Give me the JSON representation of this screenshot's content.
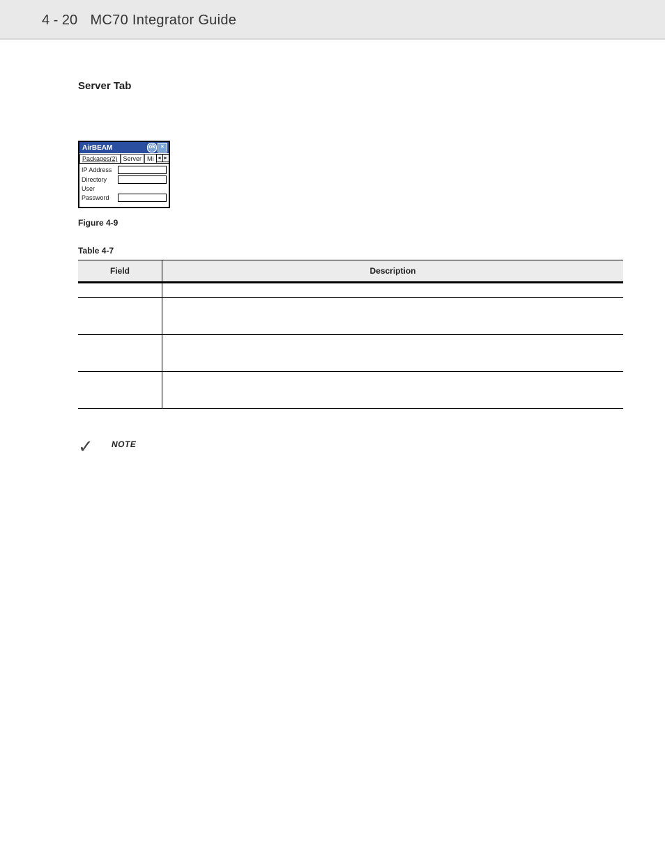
{
  "header": {
    "page_number": "4 - 20",
    "doc_title": "MC70 Integrator Guide"
  },
  "section_heading": "Server Tab",
  "device": {
    "titlebar": {
      "app": "AirBEAM",
      "ok": "ok",
      "close": "×"
    },
    "tabs": {
      "packages": "Packages(2)",
      "server": "Server",
      "mi": "Mi"
    },
    "nav": {
      "left": "◂",
      "right": "▸"
    },
    "rows": [
      {
        "label": "IP Address",
        "has_field": true
      },
      {
        "label": "Directory",
        "has_field": true
      },
      {
        "label": "User",
        "has_field": false
      },
      {
        "label": "Password",
        "has_field": true
      }
    ]
  },
  "figure_caption": "Figure 4-9",
  "table_caption": "Table 4-7",
  "table": {
    "headers": {
      "field": "Field",
      "description": "Description"
    },
    "rows": [
      {
        "field": "",
        "description": ""
      },
      {
        "field": "",
        "description": ""
      },
      {
        "field": "",
        "description": ""
      },
      {
        "field": "",
        "description": ""
      }
    ]
  },
  "note": {
    "check": "✓",
    "label": "NOTE"
  }
}
